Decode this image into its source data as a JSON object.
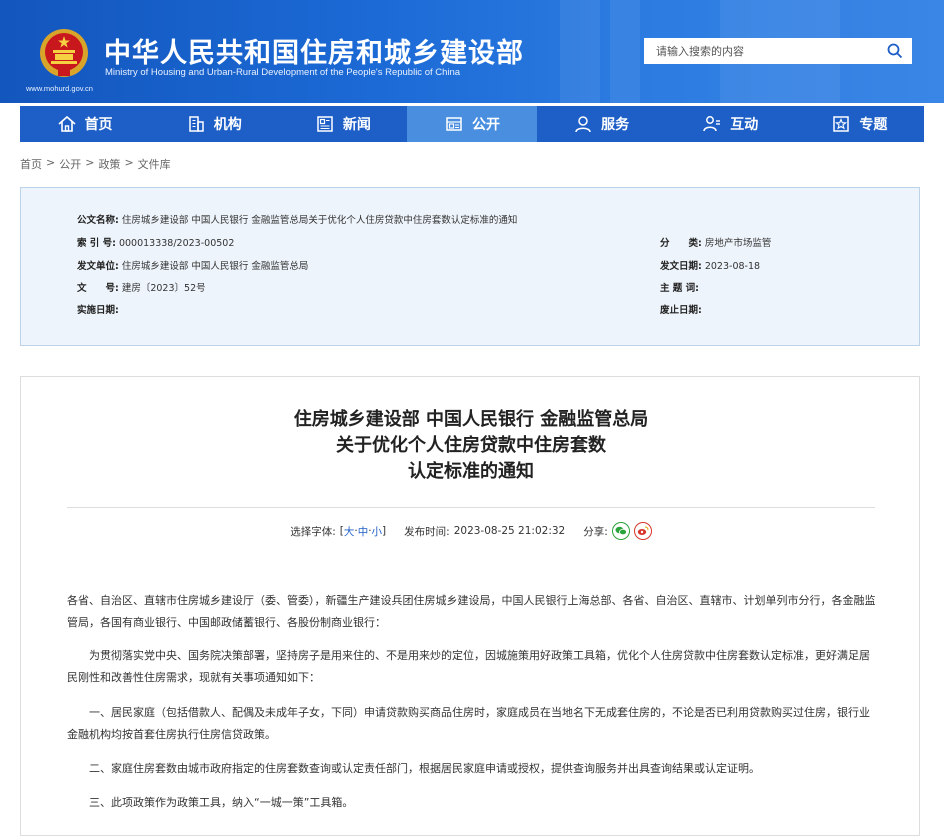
{
  "header": {
    "title": "中华人民共和国住房和城乡建设部",
    "subtitle": "Ministry of Housing and Urban-Rural Development of the People's Republic of China",
    "url": "www.mohurd.gov.cn",
    "search_placeholder": "请输入搜索的内容"
  },
  "nav": {
    "items": [
      {
        "label": "首页",
        "icon": "home-icon"
      },
      {
        "label": "机构",
        "icon": "building-icon"
      },
      {
        "label": "新闻",
        "icon": "news-icon"
      },
      {
        "label": "公开",
        "icon": "public-icon",
        "active": true
      },
      {
        "label": "服务",
        "icon": "service-icon"
      },
      {
        "label": "互动",
        "icon": "interact-icon"
      },
      {
        "label": "专题",
        "icon": "topic-icon"
      }
    ]
  },
  "breadcrumb": [
    "首页",
    "公开",
    "政策",
    "文件库"
  ],
  "meta": {
    "name_label": "公文名称:",
    "name_value": "住房城乡建设部 中国人民银行 金融监管总局关于优化个人住房贷款中住房套数认定标准的通知",
    "index_label": "索 引 号:",
    "index_value": "000013338/2023-00502",
    "category_label": "分　　类:",
    "category_value": "房地产市场监管",
    "issuer_label": "发文单位:",
    "issuer_value": "住房城乡建设部 中国人民银行 金融监管总局",
    "date_label": "发文日期:",
    "date_value": "2023-08-18",
    "docno_label": "文　　号:",
    "docno_value": "建房〔2023〕52号",
    "keywords_label": "主 题 词:",
    "keywords_value": "",
    "effective_label": "实施日期:",
    "effective_value": "",
    "expire_label": "废止日期:",
    "expire_value": ""
  },
  "doc": {
    "title_lines": [
      "住房城乡建设部 中国人民银行 金融监管总局",
      "关于优化个人住房贷款中住房套数",
      "认定标准的通知"
    ],
    "font_label": "选择字体:",
    "font_open": "[ ",
    "font_large": "大",
    "font_medium": "中",
    "font_small": "小",
    "font_sep": "·",
    "font_close": " ]",
    "publish_label": "发布时间:",
    "publish_time": "2023-08-25 21:02:32",
    "share_label": "分享:",
    "paragraphs": [
      "各省、自治区、直辖市住房城乡建设厅（委、管委），新疆生产建设兵团住房城乡建设局，中国人民银行上海总部、各省、自治区、直辖市、计划单列市分行，各金融监管局，各国有商业银行、中国邮政储蓄银行、各股份制商业银行：",
      "为贯彻落实党中央、国务院决策部署，坚持房子是用来住的、不是用来炒的定位，因城施策用好政策工具箱，优化个人住房贷款中住房套数认定标准，更好满足居民刚性和改善性住房需求，现就有关事项通知如下：",
      "一、居民家庭（包括借款人、配偶及未成年子女，下同）申请贷款购买商品住房时，家庭成员在当地名下无成套住房的，不论是否已利用贷款购买过住房，银行业金融机构均按首套住房执行住房信贷政策。",
      "二、家庭住房套数由城市政府指定的住房套数查询或认定责任部门，根据居民家庭申请或授权，提供查询服务并出具查询结果或认定证明。",
      "三、此项政策作为政策工具，纳入“一城一策”工具箱。"
    ]
  }
}
